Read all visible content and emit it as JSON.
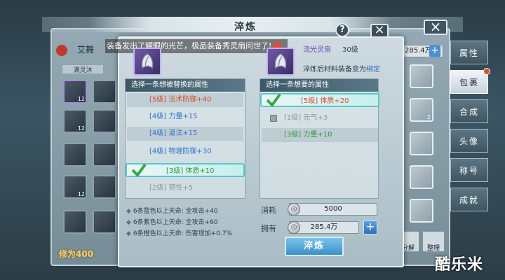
{
  "dialog": {
    "title": "淬炼",
    "help": "?",
    "close": "×",
    "broadcast": "装备发出了耀眼的光芒，极品装备秀灵扇问世了!",
    "left_panel": {
      "header": "选择一条想被替换的属性",
      "rows": [
        {
          "level": "[5级]",
          "text": "法术防御+40",
          "color": "red"
        },
        {
          "level": "[4级]",
          "text": "力量+15",
          "color": "blue"
        },
        {
          "level": "[4级]",
          "text": "道法+15",
          "color": "blue"
        },
        {
          "level": "[4级]",
          "text": "物理防御+30",
          "color": "blue"
        },
        {
          "level": "[3级]",
          "text": "体质+10",
          "color": "green",
          "selected": true
        },
        {
          "level": "[2级]",
          "text": "韧性+5",
          "color": "gray"
        }
      ]
    },
    "right_item": {
      "name": "流光灵扇",
      "level": "30级",
      "note_prefix": "淬炼后材料装备变为",
      "note_bind": "绑定"
    },
    "right_panel": {
      "header": "选择一条想要的属性",
      "rows": [
        {
          "level": "[5级]",
          "text": "体质+20",
          "color": "red",
          "selected": true
        },
        {
          "level": "[1级]",
          "text": "元气+3",
          "color": "gray"
        },
        {
          "level": "[3级]",
          "text": "力量+10",
          "color": "green"
        }
      ]
    },
    "notes": [
      "6条蓝色以上天命: 全攻击+40",
      "6条紫色以上天命: 全攻击+60",
      "6条橙色以上天命: 伤害增加+0.7%"
    ],
    "cost_label": "消耗",
    "cost_value": "5000",
    "own_label": "拥有",
    "own_value": "285.4万",
    "plus": "+",
    "action_button": "淬炼"
  },
  "background": {
    "player_name": "艾舞",
    "sub_label": "满灵沐",
    "money": "285.4万",
    "gold_text": "修为400",
    "tabs": [
      "属性",
      "包裹",
      "合成",
      "头像",
      "称号",
      "成就"
    ],
    "active_tab": "包裹",
    "bottom_buttons": [
      "分解",
      "整理"
    ],
    "slot_counts": [
      "12",
      "12",
      "12",
      "2"
    ]
  },
  "watermark": "酷乐米",
  "colors": {
    "red": "#d64a2c",
    "blue": "#2f76c9",
    "green": "#2e9a3c",
    "gray": "#8a97a0",
    "accent": "#58c8c8"
  }
}
